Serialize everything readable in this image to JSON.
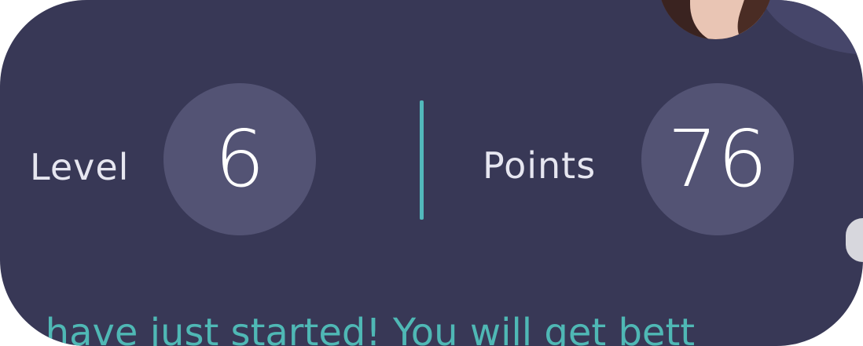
{
  "colors": {
    "card_background": "#383856",
    "circle_background": "#535374",
    "divider": "#52b8bb",
    "message_text": "#4fb8b5",
    "label_text": "#e6e6f0"
  },
  "stats": {
    "level": {
      "label": "Level",
      "value": "6"
    },
    "points": {
      "label": "Points",
      "value": "76"
    }
  },
  "message": {
    "text": "u have just started! You will get bett"
  },
  "avatar": {
    "icon": "user-avatar-photo"
  },
  "scroll": {
    "icon": "scroll-handle"
  }
}
